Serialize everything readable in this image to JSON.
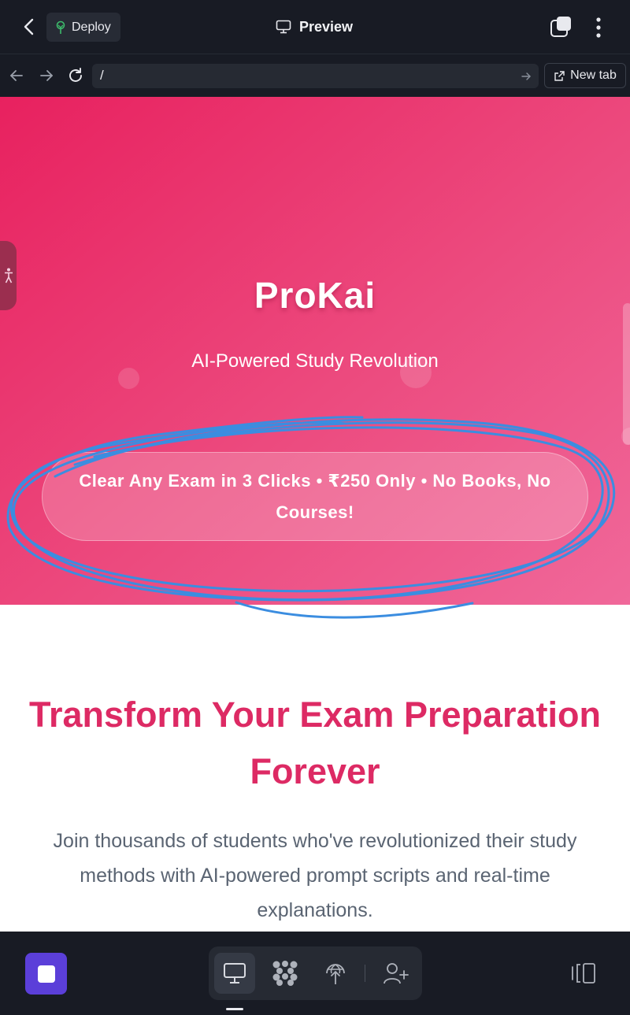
{
  "topbar": {
    "deploy_label": "Deploy",
    "title": "Preview"
  },
  "addressbar": {
    "url": "/",
    "new_tab_label": "New tab"
  },
  "hero": {
    "title": "ProKai",
    "subtitle": "AI-Powered Study Revolution",
    "cta": "Clear Any Exam in 3 Clicks • ₹250 Only • No Books, No Courses!"
  },
  "section": {
    "title": "Transform Your Exam Preparation Forever",
    "body": "Join thousands of students who've revolutionized their study methods with AI-powered prompt scripts and real-time explanations."
  },
  "colors": {
    "hero_start": "#e8215f",
    "hero_end": "#f0689a",
    "accent_title": "#dd2a64",
    "annotation_scribble": "#3b8de0",
    "stop_button": "#5b3fd9"
  },
  "icons": [
    "chevron-left-icon",
    "deploy-tree-icon",
    "monitor-icon",
    "tabs-icon",
    "more-vertical-icon",
    "arrow-left-icon",
    "arrow-right-icon",
    "reload-icon",
    "external-link-icon",
    "accessibility-icon",
    "agents-grid-icon",
    "globe-upload-icon",
    "add-user-icon",
    "panel-toggle-icon"
  ]
}
